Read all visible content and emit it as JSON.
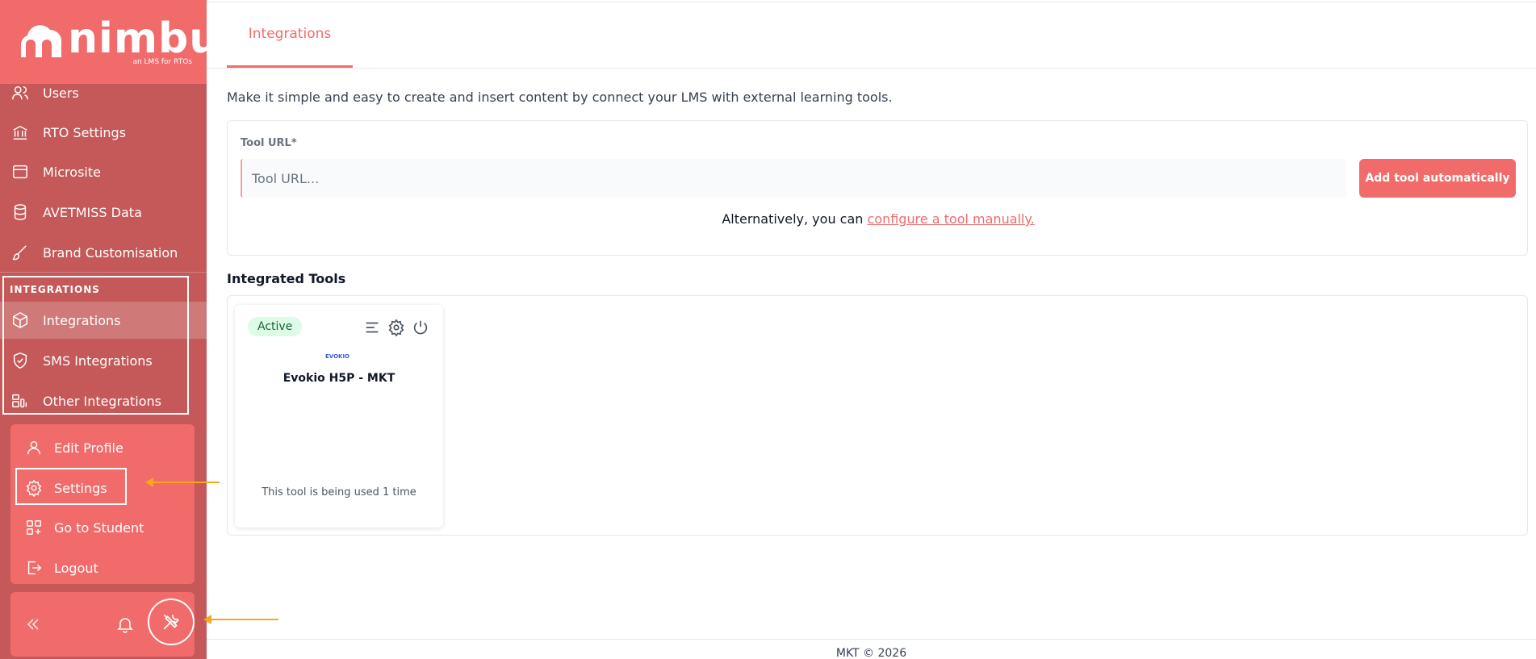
{
  "brand": {
    "name": "nimbu",
    "tagline": "an LMS for RTOs",
    "primary_color": "#f16b6b",
    "sidebar_color": "#c55858"
  },
  "sidebar": {
    "items": [
      {
        "label": "Users",
        "icon": "users-icon"
      },
      {
        "label": "RTO Settings",
        "icon": "bank-icon"
      },
      {
        "label": "Microsite",
        "icon": "window-icon"
      },
      {
        "label": "AVETMISS Data",
        "icon": "database-icon"
      },
      {
        "label": "Brand Customisation",
        "icon": "brush-icon"
      }
    ],
    "section_title": "INTEGRATIONS",
    "integration_items": [
      {
        "label": "Integrations",
        "icon": "cube-icon",
        "active": true
      },
      {
        "label": "SMS Integrations",
        "icon": "shield-check-icon"
      },
      {
        "label": "Other Integrations",
        "icon": "layout-icon"
      }
    ],
    "profile_menu": [
      {
        "label": "Edit Profile",
        "icon": "user-icon"
      },
      {
        "label": "Settings",
        "icon": "gear-icon"
      },
      {
        "label": "Go to Student",
        "icon": "apps-add-icon"
      },
      {
        "label": "Logout",
        "icon": "logout-icon"
      }
    ],
    "bottom_icons": [
      "chevrons-left-icon",
      "bell-icon",
      "tools-icon"
    ]
  },
  "main": {
    "tab": "Integrations",
    "intro": "Make it simple and easy to create and insert content by connect your LMS with external learning tools.",
    "tool_url_label": "Tool URL*",
    "tool_url_placeholder": "Tool URL...",
    "tool_url_value": "",
    "add_button": "Add tool automatically",
    "alt_prefix": "Alternatively, you can ",
    "alt_link": "configure a tool manually.",
    "integrated_heading": "Integrated Tools",
    "tools": [
      {
        "status": "Active",
        "logo_text": "EVOKIO",
        "name": "Evokio H5P - MKT",
        "usage": "This tool is being used 1 time"
      }
    ]
  },
  "footer": {
    "text": "MKT © 2026"
  }
}
